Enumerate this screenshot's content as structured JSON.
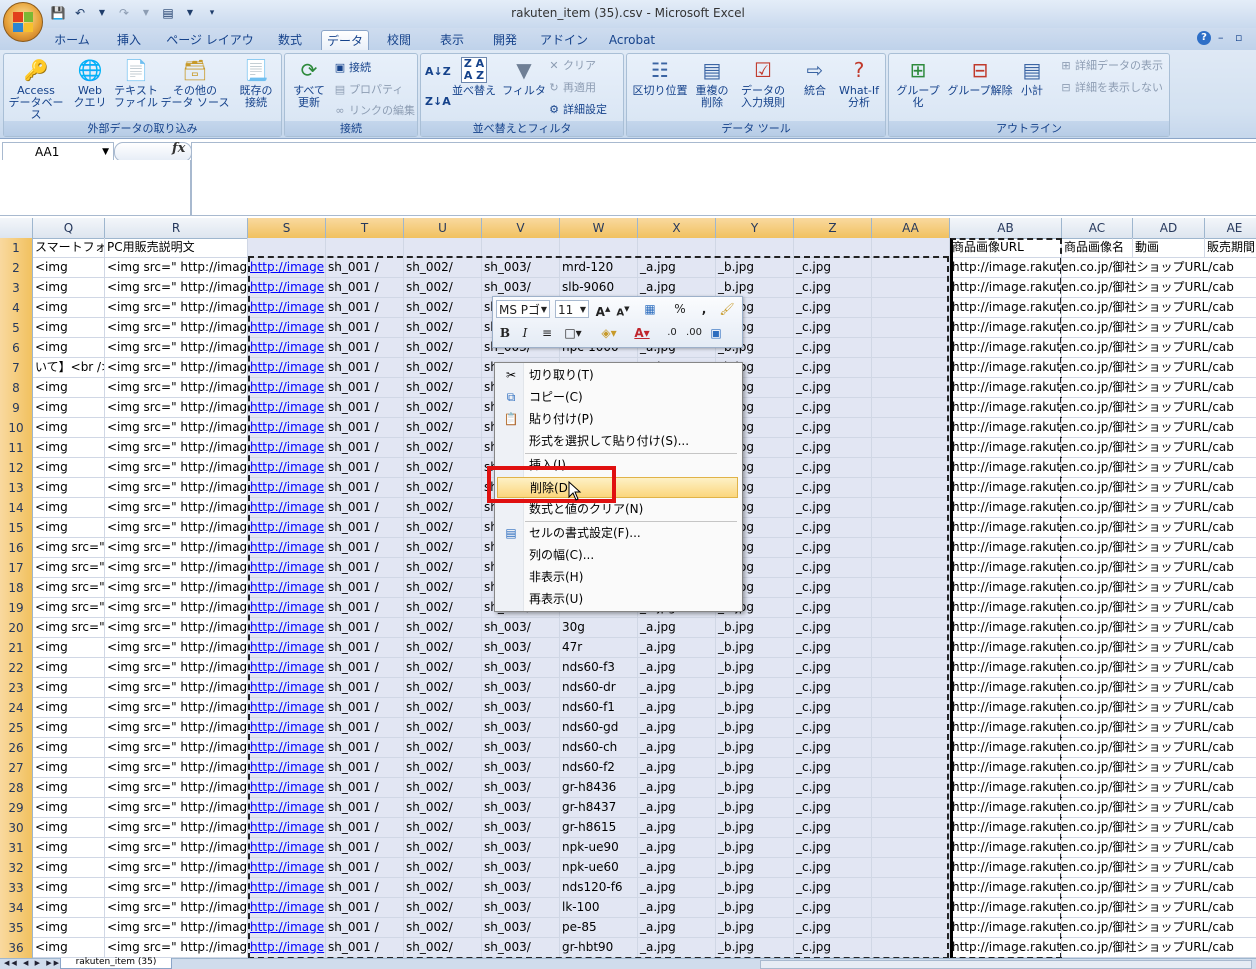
{
  "window": {
    "title": "rakuten_item (35).csv - Microsoft Excel"
  },
  "ribbon_tabs": [
    "ホーム",
    "挿入",
    "ページ レイアウト",
    "数式",
    "データ",
    "校閲",
    "表示",
    "開発",
    "アドイン",
    "Acrobat"
  ],
  "active_tab": "データ",
  "ribbon": {
    "external": {
      "label": "外部データの取り込み",
      "access": "Access\nデータベース",
      "web": "Web\nクエリ",
      "text": "テキスト\nファイル",
      "other": "その他の\nデータ ソース",
      "existing": "既存の\n接続"
    },
    "connections": {
      "label": "接続",
      "refresh": "すべて\n更新",
      "connect": "接続",
      "properties": "プロパティ",
      "edit_links": "リンクの編集"
    },
    "sort_filter": {
      "label": "並べ替えとフィルタ",
      "sort": "並べ替え",
      "filter": "フィルタ",
      "clear": "クリア",
      "reapply": "再適用",
      "advanced": "詳細設定"
    },
    "data_tools": {
      "label": "データ ツール",
      "text_to_columns": "区切り位置",
      "remove_dup": "重複の\n削除",
      "validation": "データの\n入力規則",
      "consolidate": "統合",
      "whatif": "What-If\n分析"
    },
    "outline": {
      "label": "アウトライン",
      "group": "グループ化",
      "ungroup": "グループ解除",
      "subtotal": "小計",
      "show_detail": "詳細データの表示",
      "hide_detail": "詳細を表示しない"
    }
  },
  "name_box": "AA1",
  "fx_label": "fx",
  "columns": [
    "Q",
    "R",
    "S",
    "T",
    "U",
    "V",
    "W",
    "X",
    "Y",
    "Z",
    "AA",
    "AB",
    "AC",
    "AD",
    "AE"
  ],
  "row1": {
    "Q": "スマートフォン",
    "R": "PC用販売説明文",
    "AB": "商品画像URL",
    "AC": "商品画像名",
    "AD": "動画",
    "AE": "販売期間"
  },
  "col_w_values": [
    "mrd-120",
    "slb-9060",
    "",
    "",
    "npc-1000",
    "",
    "",
    "",
    "",
    "",
    "",
    "",
    "",
    "",
    "",
    "",
    "",
    "",
    "30g",
    "47r",
    "nds60-f3",
    "nds60-dr",
    "nds60-f1",
    "nds60-gd",
    "nds60-ch",
    "nds60-f2",
    "gr-h8436",
    "gr-h8437",
    "gr-h8615",
    "npk-ue90",
    "npk-ue60",
    "nds120-f6",
    "lk-100",
    "pe-85",
    "gr-hbt90"
  ],
  "col_q_values": [
    "<img",
    "<img",
    "<img",
    "<img",
    "<img",
    "いて】<br />",
    "<img",
    "<img",
    "<img",
    "<img",
    "<img",
    "<img",
    "<img",
    "<img",
    "<img src=\"",
    "<img src=\"",
    "<img src=\"",
    "<img src=\"",
    "<img src=\"",
    "<img",
    "<img",
    "<img",
    "<img",
    "<img",
    "<img",
    "<img",
    "<img",
    "<img",
    "<img",
    "<img",
    "<img",
    "<img",
    "<img",
    "<img",
    "<img"
  ],
  "cells": {
    "R": "<img src=\" http://image",
    "S": "http://image",
    "T": "sh_001 /",
    "U": "sh_002/",
    "V": "sh_003/",
    "X": "_a.jpg",
    "Y": "_b.jpg",
    "Z": "_c.jpg",
    "AB": "http://image.rakuten.co.jp/御社ショップURL/cab"
  },
  "mini_toolbar": {
    "font": "MS Pゴ",
    "size": "11",
    "percent": "%",
    "comma": ","
  },
  "context_menu": [
    "切り取り(T)",
    "コピー(C)",
    "貼り付け(P)",
    "形式を選択して貼り付け(S)...",
    "挿入(I)",
    "削除(D)",
    "数式と値のクリア(N)",
    "セルの書式設定(F)...",
    "列の幅(C)...",
    "非表示(H)",
    "再表示(U)"
  ],
  "sheet_tab": "rakuten_item (35)",
  "highlight_color": "#e01010"
}
